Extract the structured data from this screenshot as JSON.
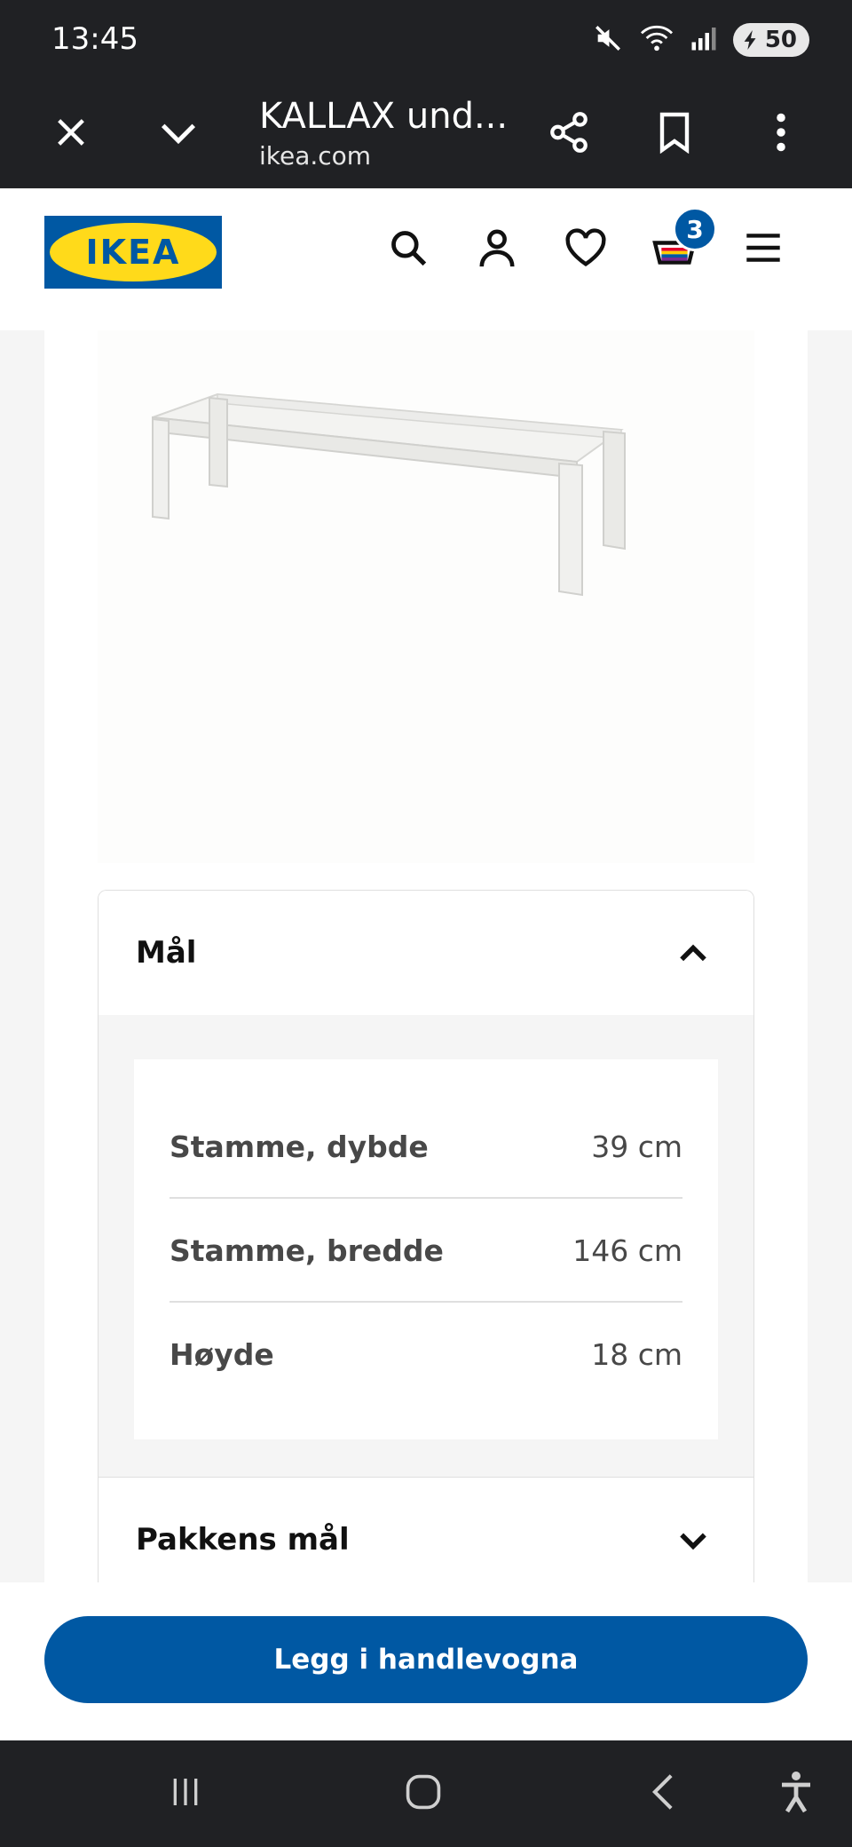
{
  "status_bar": {
    "time": "13:45",
    "battery": "50",
    "icons": [
      "mute-icon",
      "wifi-icon",
      "signal-icon",
      "battery-icon"
    ]
  },
  "browser": {
    "page_title": "KALLAX und...",
    "domain": "ikea.com"
  },
  "header": {
    "logo_text": "IKEA",
    "cart_count": "3",
    "colors": {
      "brand_blue": "#0058a3",
      "brand_yellow": "#ffda1a"
    }
  },
  "accordion_dimensions": {
    "title": "Mål",
    "rows": [
      {
        "label": "Stamme, dybde",
        "value": "39 cm"
      },
      {
        "label": "Stamme, bredde",
        "value": "146 cm"
      },
      {
        "label": "Høyde",
        "value": "18 cm"
      }
    ]
  },
  "accordion_package": {
    "title": "Pakkens mål"
  },
  "cta": {
    "label": "Legg i handlevogna"
  }
}
